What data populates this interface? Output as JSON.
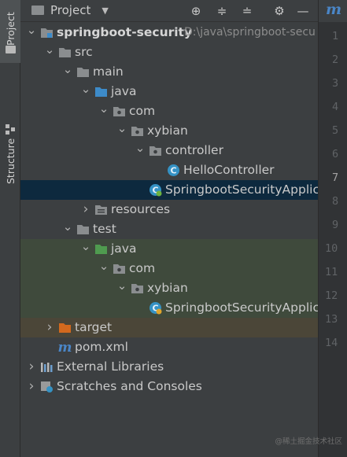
{
  "side_strip": {
    "project_tab": "Project",
    "structure_tab": "Structure"
  },
  "toolbar": {
    "title": "Project",
    "dropdown_glyph": "▼",
    "buttons": [
      {
        "name": "locate-icon",
        "glyph": "⊕"
      },
      {
        "name": "expand-all-icon",
        "glyph": "≑"
      },
      {
        "name": "collapse-all-icon",
        "glyph": "≐"
      },
      {
        "name": "gear-icon",
        "glyph": "⚙"
      },
      {
        "name": "hide-icon",
        "glyph": "—"
      }
    ]
  },
  "tree": [
    {
      "label": "springboot-security",
      "path": "D:\\java\\springboot-secu",
      "depth": 0,
      "arrow": "down",
      "icon": "module-folder-icon",
      "bold": true
    },
    {
      "label": "src",
      "depth": 1,
      "arrow": "down",
      "icon": "folder-icon"
    },
    {
      "label": "main",
      "depth": 2,
      "arrow": "down",
      "icon": "folder-icon"
    },
    {
      "label": "java",
      "depth": 3,
      "arrow": "down",
      "icon": "source-folder-icon"
    },
    {
      "label": "com",
      "depth": 4,
      "arrow": "down",
      "icon": "package-icon"
    },
    {
      "label": "xybian",
      "depth": 5,
      "arrow": "down",
      "icon": "package-icon"
    },
    {
      "label": "controller",
      "depth": 6,
      "arrow": "down",
      "icon": "package-icon"
    },
    {
      "label": "HelloController",
      "depth": 7,
      "arrow": "none",
      "icon": "java-class-icon"
    },
    {
      "label": "SpringbootSecurityApplica",
      "depth": 6,
      "arrow": "none",
      "icon": "spring-boot-class-icon",
      "highlight": "selected"
    },
    {
      "label": "resources",
      "depth": 3,
      "arrow": "right",
      "icon": "resources-folder-icon"
    },
    {
      "label": "test",
      "depth": 2,
      "arrow": "down",
      "icon": "folder-icon"
    },
    {
      "label": "java",
      "depth": 3,
      "arrow": "down",
      "icon": "test-source-folder-icon",
      "highlight": "test"
    },
    {
      "label": "com",
      "depth": 4,
      "arrow": "down",
      "icon": "package-icon",
      "highlight": "test"
    },
    {
      "label": "xybian",
      "depth": 5,
      "arrow": "down",
      "icon": "package-icon",
      "highlight": "test"
    },
    {
      "label": "SpringbootSecurityApplica",
      "depth": 6,
      "arrow": "none",
      "icon": "spring-test-class-icon",
      "highlight": "test"
    },
    {
      "label": "target",
      "depth": 1,
      "arrow": "right",
      "icon": "excluded-folder-icon",
      "highlight": "excluded"
    },
    {
      "label": "pom.xml",
      "depth": 1,
      "arrow": "none",
      "icon": "maven-icon"
    },
    {
      "label": "External Libraries",
      "depth": 0,
      "arrow": "right",
      "icon": "libraries-icon"
    },
    {
      "label": "Scratches and Consoles",
      "depth": 0,
      "arrow": "right",
      "icon": "scratches-icon"
    }
  ],
  "editor_gutter": {
    "tab_logo": "m",
    "line_numbers": [
      "1",
      "2",
      "3",
      "4",
      "5",
      "6",
      "7",
      "8",
      "9",
      "10",
      "11",
      "12",
      "13",
      "14"
    ],
    "current_line": "7"
  },
  "watermark": "@稀土掘金技术社区",
  "colors": {
    "selection": "#0d293e",
    "test_tint": "#3f4a3c",
    "excluded_tint": "#4b4638",
    "folder": "#8a8d8f",
    "source_folder": "#3d8bc9",
    "test_folder": "#4f9b4f",
    "excluded_folder": "#d2691e",
    "class_icon": "#3592c4",
    "maven_blue": "#4a86c7"
  }
}
